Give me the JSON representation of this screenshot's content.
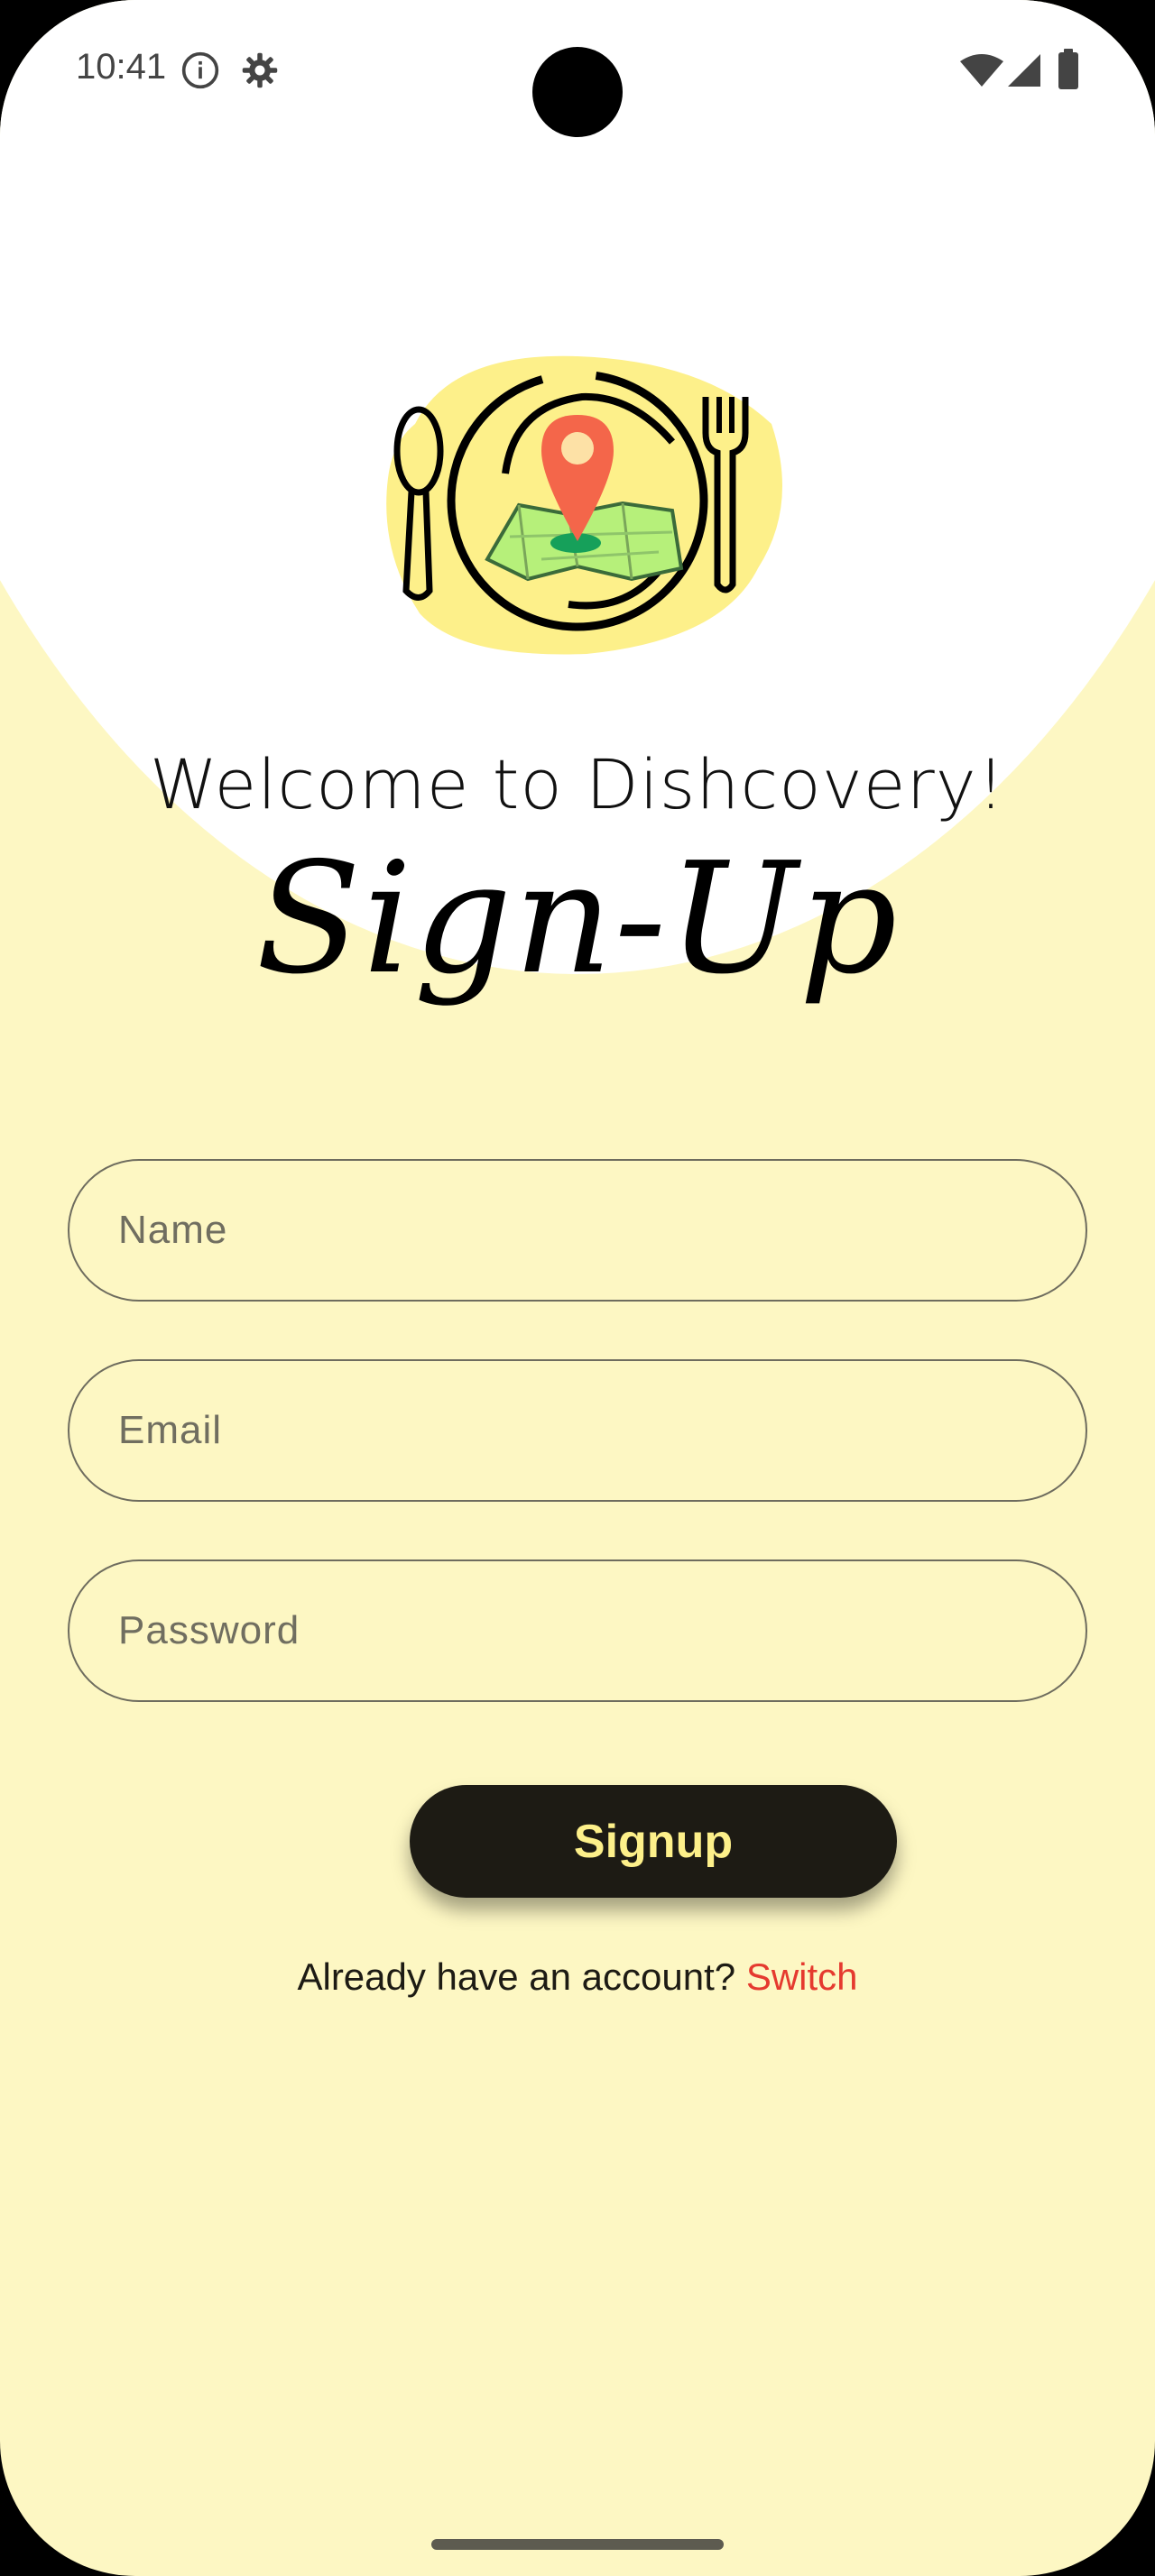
{
  "status_bar": {
    "time": "10:41",
    "icons": [
      "info-icon",
      "gear-icon",
      "wifi-icon",
      "signal-icon",
      "battery-icon"
    ]
  },
  "header": {
    "welcome_text": "Welcome to Dishcovery!",
    "title": "Sign-Up"
  },
  "form": {
    "name_placeholder": "Name",
    "name_value": "",
    "email_placeholder": "Email",
    "email_value": "",
    "password_placeholder": "Password",
    "password_value": "",
    "submit_label": "Signup"
  },
  "footer": {
    "account_prompt": "Already have an account?",
    "switch_label": "Switch"
  },
  "colors": {
    "background": "#fdf7c3",
    "top_background": "#ffffff",
    "button_bg": "#1d1b14",
    "button_text": "#fdf08a",
    "link": "#e53a2f",
    "field_border": "#6e6c5e"
  }
}
